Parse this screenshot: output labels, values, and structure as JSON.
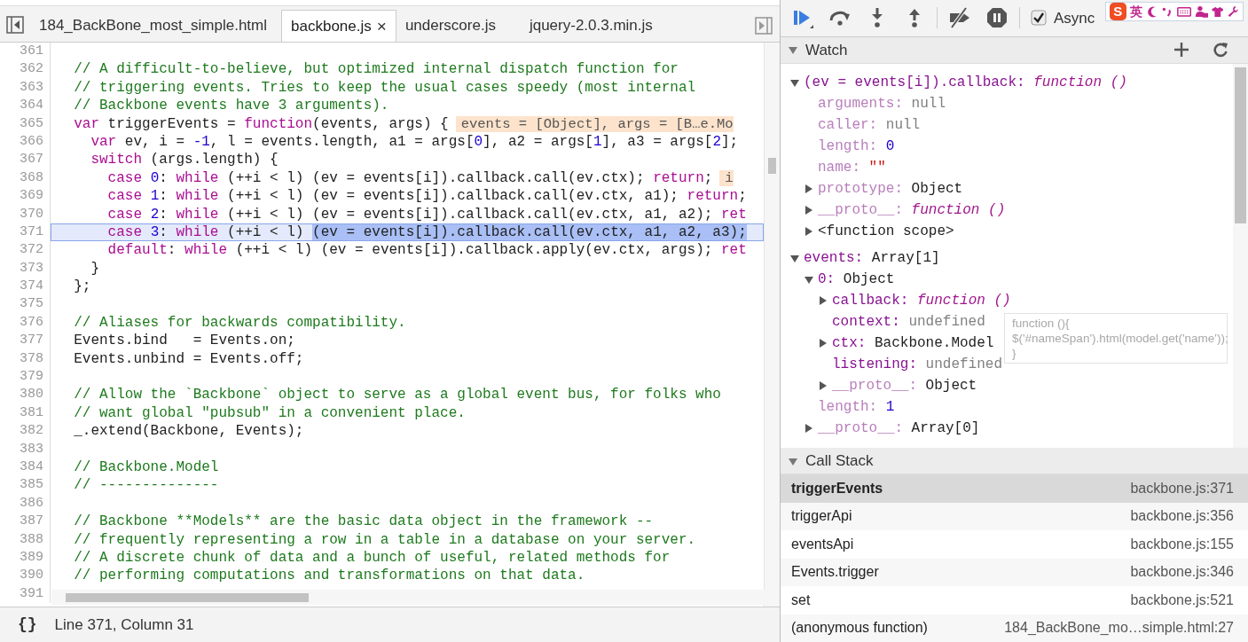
{
  "tabs": [
    {
      "label": "184_BackBone_most_simple.html",
      "selected": false
    },
    {
      "label": "backbone.js",
      "selected": true,
      "close_label": "×"
    },
    {
      "label": "underscore.js",
      "selected": false
    },
    {
      "label": "jquery-2.0.3.min.js",
      "selected": false
    }
  ],
  "code_lines": [
    {
      "number": "361",
      "current": false
    },
    {
      "number": "362",
      "current": false,
      "tokens": [
        {
          "kind": "comment",
          "text": "  // A difficult-to-believe, but optimized internal dispatch function for"
        }
      ]
    },
    {
      "number": "363",
      "current": false,
      "tokens": [
        {
          "kind": "comment",
          "text": "  // triggering events. Tries to keep the usual cases speedy (most internal"
        }
      ]
    },
    {
      "number": "364",
      "current": false,
      "tokens": [
        {
          "kind": "comment",
          "text": "  // Backbone events have 3 arguments)."
        }
      ]
    },
    {
      "number": "365",
      "current": false,
      "tokens": [
        {
          "kind": "keyword",
          "text": "  var"
        },
        {
          "kind": "plain",
          "text": " triggerEvents = "
        },
        {
          "kind": "keyword",
          "text": "function"
        },
        {
          "kind": "plain",
          "text": "(events, args) {"
        },
        {
          "kind": "annotation",
          "text": "events = [Object], args = [B…e.Mo"
        }
      ]
    },
    {
      "number": "366",
      "current": false,
      "tokens": [
        {
          "kind": "keyword",
          "text": "    var"
        },
        {
          "kind": "plain",
          "text": " ev, i = "
        },
        {
          "kind": "number",
          "text": "-1"
        },
        {
          "kind": "plain",
          "text": ", l = events.length, a1 = args["
        },
        {
          "kind": "number",
          "text": "0"
        },
        {
          "kind": "plain",
          "text": "], a2 = args["
        },
        {
          "kind": "number",
          "text": "1"
        },
        {
          "kind": "plain",
          "text": "], a3 = args["
        },
        {
          "kind": "number",
          "text": "2"
        },
        {
          "kind": "plain",
          "text": "];"
        }
      ]
    },
    {
      "number": "367",
      "current": false,
      "tokens": [
        {
          "kind": "keyword",
          "text": "    switch"
        },
        {
          "kind": "plain",
          "text": " (args.length) {"
        }
      ]
    },
    {
      "number": "368",
      "current": false,
      "tokens": [
        {
          "kind": "keyword",
          "text": "      case "
        },
        {
          "kind": "number",
          "text": "0"
        },
        {
          "kind": "plain",
          "text": ": "
        },
        {
          "kind": "keyword",
          "text": "while"
        },
        {
          "kind": "plain",
          "text": " (++i < l) (ev = events[i]).callback.call(ev.ctx); "
        },
        {
          "kind": "keyword",
          "text": "return"
        },
        {
          "kind": "plain",
          "text": ";"
        },
        {
          "kind": "annotation",
          "text": "i"
        }
      ]
    },
    {
      "number": "369",
      "current": false,
      "tokens": [
        {
          "kind": "keyword",
          "text": "      case "
        },
        {
          "kind": "number",
          "text": "1"
        },
        {
          "kind": "plain",
          "text": ": "
        },
        {
          "kind": "keyword",
          "text": "while"
        },
        {
          "kind": "plain",
          "text": " (++i < l) (ev = events[i]).callback.call(ev.ctx, a1); "
        },
        {
          "kind": "keyword",
          "text": "return"
        },
        {
          "kind": "plain",
          "text": ";"
        }
      ]
    },
    {
      "number": "370",
      "current": false,
      "tokens": [
        {
          "kind": "keyword",
          "text": "      case "
        },
        {
          "kind": "number",
          "text": "2"
        },
        {
          "kind": "plain",
          "text": ": "
        },
        {
          "kind": "keyword",
          "text": "while"
        },
        {
          "kind": "plain",
          "text": " (++i < l) (ev = events[i]).callback.call(ev.ctx, a1, a2); "
        },
        {
          "kind": "keyword",
          "text": "ret"
        }
      ]
    },
    {
      "number": "371",
      "current": true,
      "tokens": [
        {
          "kind": "keyword",
          "text": "      case "
        },
        {
          "kind": "number",
          "text": "3"
        },
        {
          "kind": "plain",
          "text": ": "
        },
        {
          "kind": "keyword",
          "text": "while"
        },
        {
          "kind": "plain",
          "text": " (++i < l) "
        },
        {
          "kind": "selection",
          "text": "(ev = events[i]).callback.call(ev.ctx, a1, a2, a3);"
        }
      ]
    },
    {
      "number": "372",
      "current": false,
      "tokens": [
        {
          "kind": "keyword",
          "text": "      default"
        },
        {
          "kind": "plain",
          "text": ": "
        },
        {
          "kind": "keyword",
          "text": "while"
        },
        {
          "kind": "plain",
          "text": " (++i < l) (ev = events[i]).callback.apply(ev.ctx, args); "
        },
        {
          "kind": "keyword",
          "text": "ret"
        }
      ]
    },
    {
      "number": "373",
      "current": false,
      "tokens": [
        {
          "kind": "plain",
          "text": "    }"
        }
      ]
    },
    {
      "number": "374",
      "current": false,
      "tokens": [
        {
          "kind": "plain",
          "text": "  };"
        }
      ]
    },
    {
      "number": "375",
      "current": false
    },
    {
      "number": "376",
      "current": false,
      "tokens": [
        {
          "kind": "comment",
          "text": "  // Aliases for backwards compatibility."
        }
      ]
    },
    {
      "number": "377",
      "current": false,
      "tokens": [
        {
          "kind": "plain",
          "text": "  Events.bind   = Events.on;"
        }
      ]
    },
    {
      "number": "378",
      "current": false,
      "tokens": [
        {
          "kind": "plain",
          "text": "  Events.unbind = Events.off;"
        }
      ]
    },
    {
      "number": "379",
      "current": false
    },
    {
      "number": "380",
      "current": false,
      "tokens": [
        {
          "kind": "comment",
          "text": "  // Allow the `Backbone` object to serve as a global event bus, for folks who"
        }
      ]
    },
    {
      "number": "381",
      "current": false,
      "tokens": [
        {
          "kind": "comment",
          "text": "  // want global \"pubsub\" in a convenient place."
        }
      ]
    },
    {
      "number": "382",
      "current": false,
      "tokens": [
        {
          "kind": "plain",
          "text": "  _.extend(Backbone, Events);"
        }
      ]
    },
    {
      "number": "383",
      "current": false
    },
    {
      "number": "384",
      "current": false,
      "tokens": [
        {
          "kind": "comment",
          "text": "  // Backbone.Model"
        }
      ]
    },
    {
      "number": "385",
      "current": false,
      "tokens": [
        {
          "kind": "comment",
          "text": "  // --------------"
        }
      ]
    },
    {
      "number": "386",
      "current": false
    },
    {
      "number": "387",
      "current": false,
      "tokens": [
        {
          "kind": "comment",
          "text": "  // Backbone **Models** are the basic data object in the framework --"
        }
      ]
    },
    {
      "number": "388",
      "current": false,
      "tokens": [
        {
          "kind": "comment",
          "text": "  // frequently representing a row in a table in a database on your server."
        }
      ]
    },
    {
      "number": "389",
      "current": false,
      "tokens": [
        {
          "kind": "comment",
          "text": "  // A discrete chunk of data and a bunch of useful, related methods for"
        }
      ]
    },
    {
      "number": "390",
      "current": false,
      "tokens": [
        {
          "kind": "comment",
          "text": "  // performing computations and transformations on that data."
        }
      ]
    },
    {
      "number": "391",
      "current": false
    }
  ],
  "status_bar": {
    "format_button": "{}",
    "position": "Line 371, Column 31"
  },
  "ime_toolbar": {
    "logo": "S",
    "mode": "英"
  },
  "debugger_toolbar": {
    "async": {
      "label": "Async",
      "checked": true
    }
  },
  "watch": {
    "title": "Watch",
    "expanded": true,
    "items": [
      {
        "kind": "branch",
        "expanded": true,
        "key": {
          "kind": "own",
          "text": "(ev = events[i]).callback:"
        },
        "value": {
          "kind": "function",
          "text": "function ()"
        },
        "children": [
          {
            "kind": "leaf",
            "key": {
              "kind": "inherited",
              "text": "arguments:"
            },
            "value": {
              "kind": "null",
              "text": "null"
            }
          },
          {
            "kind": "leaf",
            "key": {
              "kind": "inherited",
              "text": "caller:"
            },
            "value": {
              "kind": "null",
              "text": "null"
            }
          },
          {
            "kind": "leaf",
            "key": {
              "kind": "inherited",
              "text": "length:"
            },
            "value": {
              "kind": "number",
              "text": "0"
            }
          },
          {
            "kind": "leaf",
            "key": {
              "kind": "inherited",
              "text": "name:"
            },
            "value": {
              "kind": "string",
              "text": "\"\""
            }
          },
          {
            "kind": "branch",
            "expanded": false,
            "key": {
              "kind": "inherited",
              "text": "prototype:"
            },
            "value": {
              "kind": "object",
              "text": "Object"
            }
          },
          {
            "kind": "branch",
            "expanded": false,
            "key": {
              "kind": "inherited",
              "text": "__proto__:"
            },
            "value": {
              "kind": "function",
              "text": "function ()"
            }
          },
          {
            "kind": "branch",
            "expanded": false,
            "key": {
              "kind": "plain",
              "text": "<function scope>"
            }
          }
        ]
      },
      {
        "kind": "branch",
        "expanded": true,
        "key": {
          "kind": "own",
          "text": "events:"
        },
        "value": {
          "kind": "object",
          "text": "Array[1]"
        },
        "children": [
          {
            "kind": "branch",
            "expanded": true,
            "key": {
              "kind": "own",
              "text": "0:"
            },
            "value": {
              "kind": "object",
              "text": "Object"
            },
            "children": [
              {
                "kind": "branch",
                "expanded": false,
                "key": {
                  "kind": "own",
                  "text": "callback:"
                },
                "value": {
                  "kind": "function",
                  "text": "function ()"
                }
              },
              {
                "kind": "leaf",
                "key": {
                  "kind": "own",
                  "text": "context:"
                },
                "value": {
                  "kind": "undefined",
                  "text": "undefined"
                }
              },
              {
                "kind": "branch",
                "expanded": false,
                "key": {
                  "kind": "own",
                  "text": "ctx:"
                },
                "value": {
                  "kind": "object",
                  "text": "Backbone.Model"
                }
              },
              {
                "kind": "leaf",
                "key": {
                  "kind": "own",
                  "text": "listening:"
                },
                "value": {
                  "kind": "undefined",
                  "text": "undefined"
                }
              },
              {
                "kind": "branch",
                "expanded": false,
                "key": {
                  "kind": "inherited",
                  "text": "__proto__:"
                },
                "value": {
                  "kind": "object",
                  "text": "Object"
                }
              }
            ]
          },
          {
            "kind": "leaf",
            "key": {
              "kind": "inherited",
              "text": "length:"
            },
            "value": {
              "kind": "number",
              "text": "1"
            }
          },
          {
            "kind": "branch",
            "expanded": false,
            "key": {
              "kind": "inherited",
              "text": "__proto__:"
            },
            "value": {
              "kind": "object",
              "text": "Array[0]"
            }
          }
        ]
      }
    ],
    "tooltip": "function (){ $('#nameSpan').html(model.get('name')); }"
  },
  "call_stack": {
    "title": "Call Stack",
    "expanded": true,
    "frames": [
      {
        "name": "triggerEvents",
        "location": "backbone.js:371",
        "selected": true
      },
      {
        "name": "triggerApi",
        "location": "backbone.js:356",
        "selected": false
      },
      {
        "name": "eventsApi",
        "location": "backbone.js:155",
        "selected": false
      },
      {
        "name": "Events.trigger",
        "location": "backbone.js:346",
        "selected": false
      },
      {
        "name": "set",
        "location": "backbone.js:521",
        "selected": false
      },
      {
        "name": "(anonymous function)",
        "location": "184_BackBone_mo…simple.html:27",
        "selected": false
      }
    ]
  }
}
